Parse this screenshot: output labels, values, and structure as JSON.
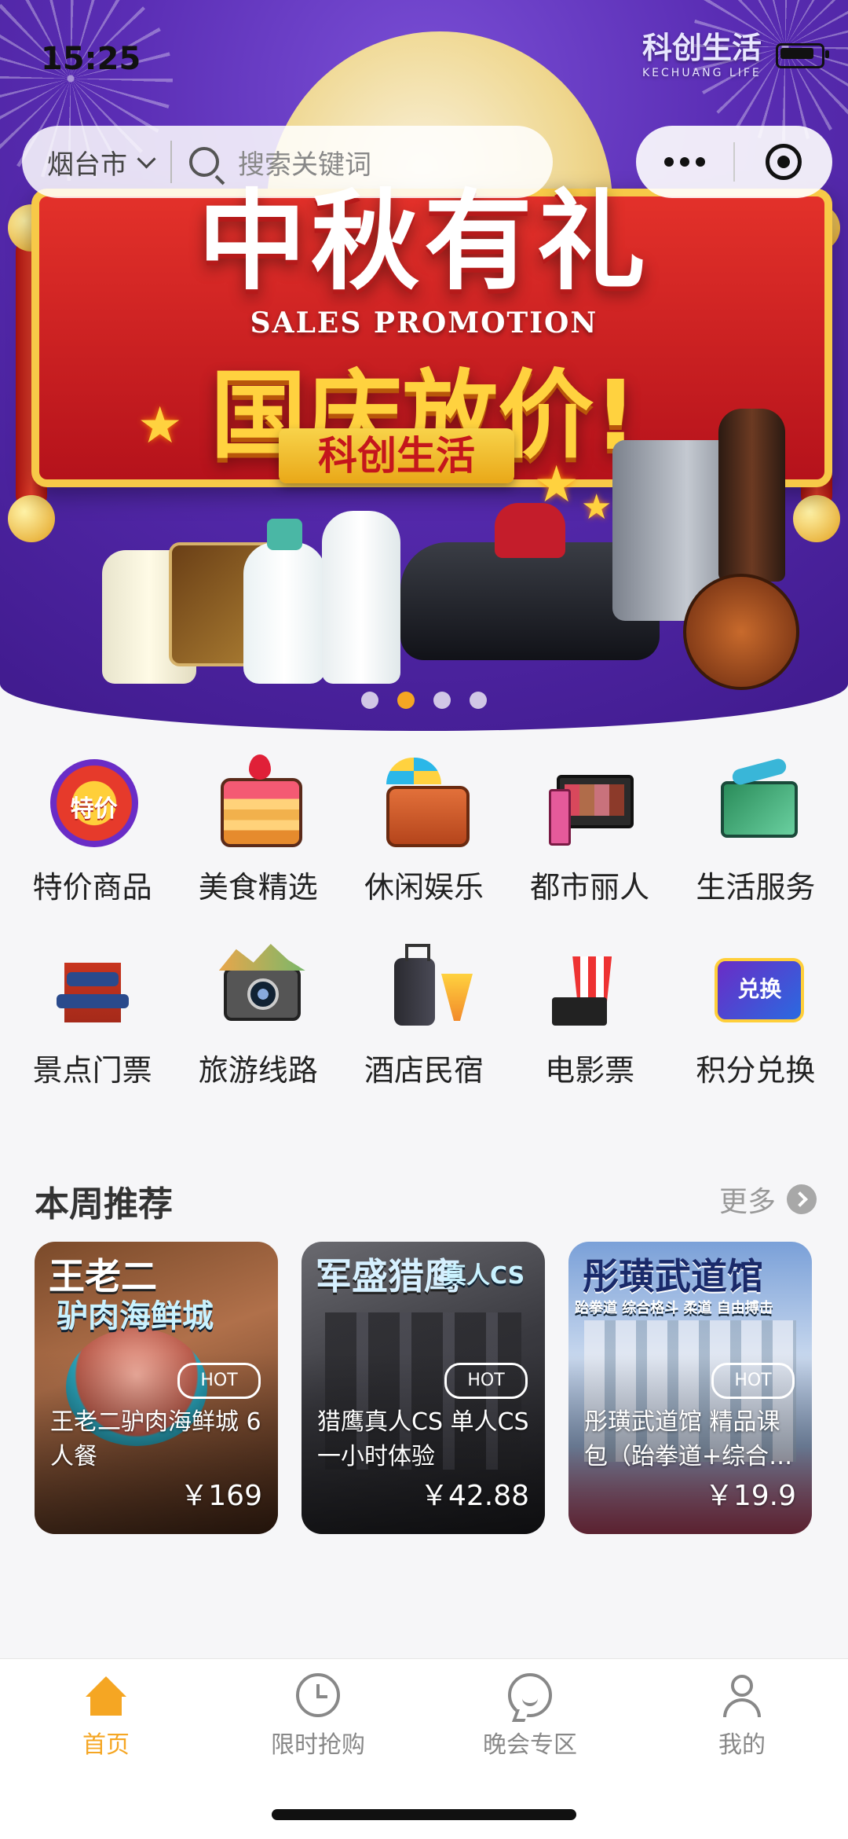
{
  "status_bar": {
    "time": "15:25",
    "battery_level": 0.75
  },
  "brand_logo": {
    "name": "科创生活",
    "sub": "KECHUANG LIFE"
  },
  "search": {
    "city": "烟台市",
    "placeholder": "搜索关键词"
  },
  "banner": {
    "headline_top": "中秋有礼",
    "tagline": "SALES PROMOTION",
    "headline_bottom": "国庆放价!",
    "brand_ribbon": "科创生活",
    "slide_count": 4,
    "active_slide": 2
  },
  "categories": [
    {
      "label": "特价商品",
      "icon": "special-offer-icon"
    },
    {
      "label": "美食精选",
      "icon": "cake-icon"
    },
    {
      "label": "休闲娱乐",
      "icon": "suitcase-icon"
    },
    {
      "label": "都市丽人",
      "icon": "makeup-palette-icon"
    },
    {
      "label": "生活服务",
      "icon": "life-service-icon"
    },
    {
      "label": "景点门票",
      "icon": "temple-icon"
    },
    {
      "label": "旅游线路",
      "icon": "camera-icon"
    },
    {
      "label": "酒店民宿",
      "icon": "luggage-icon"
    },
    {
      "label": "电影票",
      "icon": "popcorn-icon"
    },
    {
      "label": "积分兑换",
      "icon": "points-exchange-icon"
    }
  ],
  "weekly": {
    "title": "本周推荐",
    "more_label": "更多",
    "items": [
      {
        "top_title": "王老二",
        "top_sub": "驴肉海鲜城",
        "badge": "HOT",
        "name": "王老二驴肉海鲜城 6人餐",
        "price": "￥169"
      },
      {
        "top_title": "军盛猎鹰",
        "top_sub": "真人CS",
        "badge": "HOT",
        "name": "猎鹰真人CS 单人CS一小时体验",
        "price": "￥42.88"
      },
      {
        "top_title": "彤璜武道馆",
        "top_sub": "跆拳道 综合格斗 柔道 自由搏击",
        "badge": "HOT",
        "name": "彤璜武道馆 精品课包（跆拳道+综合格斗）",
        "price": "￥19.9"
      }
    ]
  },
  "tabbar": {
    "tabs": [
      {
        "label": "首页",
        "icon": "home-icon",
        "active": true
      },
      {
        "label": "限时抢购",
        "icon": "clock-icon",
        "active": false
      },
      {
        "label": "晚会专区",
        "icon": "chat-bubble-icon",
        "active": false
      },
      {
        "label": "我的",
        "icon": "user-icon",
        "active": false
      }
    ]
  },
  "colors": {
    "accent": "#f5a623",
    "hero_purple": "#5a2db4",
    "banner_red": "#c4161c",
    "gold": "#ffd23f"
  }
}
